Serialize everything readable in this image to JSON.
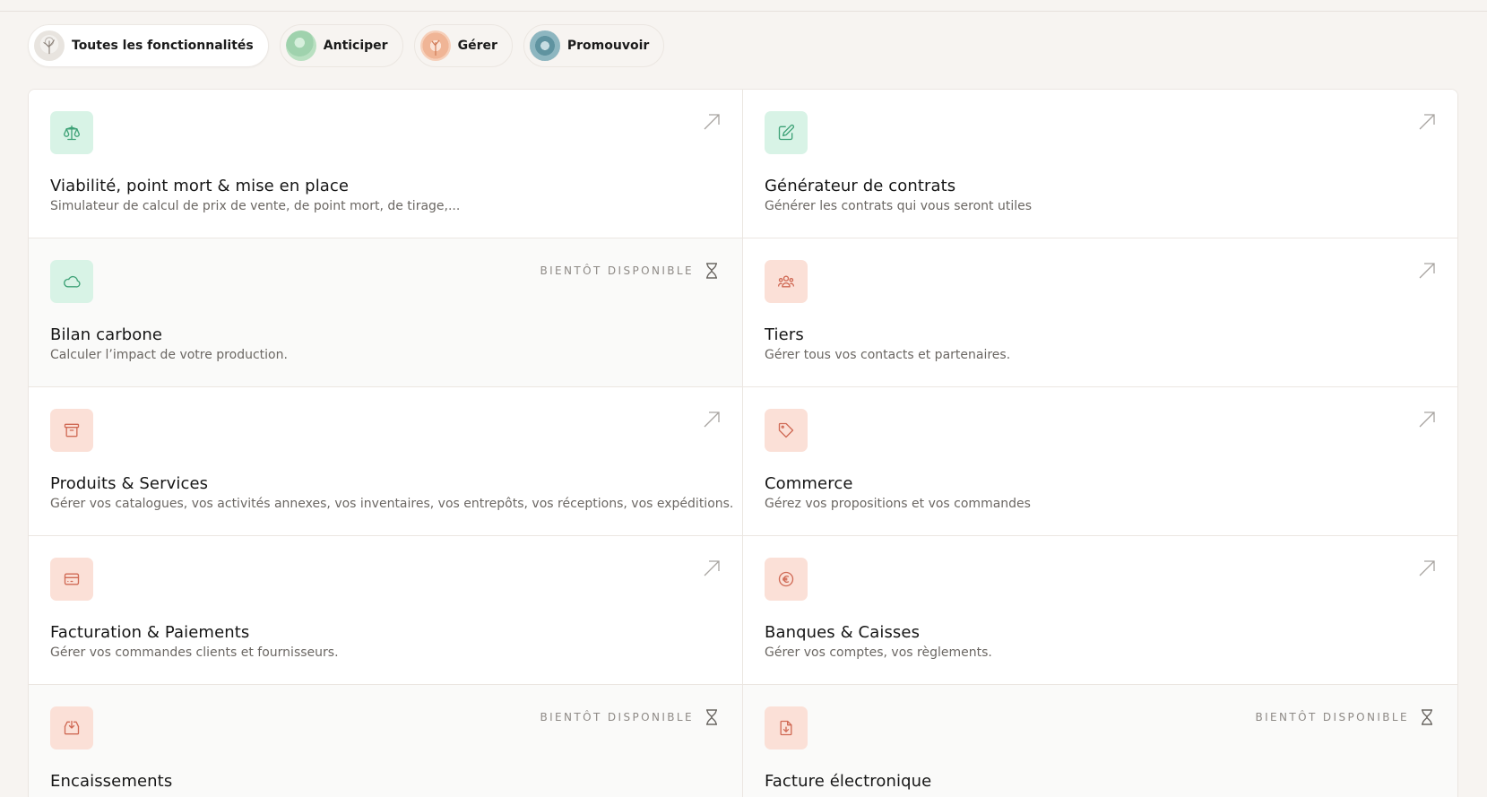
{
  "filters": [
    {
      "label": "Toutes les fonctionnalités",
      "active": true,
      "icon": "tree-thumbnail"
    },
    {
      "label": "Anticiper",
      "active": false,
      "icon": "green-leaf-thumbnail"
    },
    {
      "label": "Gérer",
      "active": false,
      "icon": "orange-tree-thumbnail"
    },
    {
      "label": "Promouvoir",
      "active": false,
      "icon": "blue-coral-thumbnail"
    }
  ],
  "soon_label": "BIENTÔT DISPONIBLE",
  "cards": [
    {
      "title": "Viabilité, point mort & mise en place",
      "desc": "Simulateur de calcul de prix de vente, de point mort, de tirage,...",
      "icon": "scale-icon",
      "color": "#d8f3e6",
      "available": true
    },
    {
      "title": "Générateur de contrats",
      "desc": "Générer les contrats qui vous seront utiles",
      "icon": "edit-icon",
      "color": "#d8f3e6",
      "available": true
    },
    {
      "title": "Bilan carbone",
      "desc": "Calculer l’impact de votre production.",
      "icon": "cloud-icon",
      "color": "#d8f3e6",
      "available": false
    },
    {
      "title": "Tiers",
      "desc": "Gérer tous vos contacts et partenaires.",
      "icon": "users-icon",
      "color": "#fbe0d7",
      "available": true
    },
    {
      "title": "Produits & Services",
      "desc": "Gérer vos catalogues, vos activités annexes, vos inventaires, vos entrepôts, vos réceptions, vos expéditions.",
      "icon": "archive-icon",
      "color": "#fbe0d7",
      "available": true
    },
    {
      "title": "Commerce",
      "desc": "Gérez vos propositions et vos commandes",
      "icon": "tag-icon",
      "color": "#fbe0d7",
      "available": true
    },
    {
      "title": "Facturation & Paiements",
      "desc": "Gérer vos commandes clients et fournisseurs.",
      "icon": "card-icon",
      "color": "#fbe0d7",
      "available": true
    },
    {
      "title": "Banques & Caisses",
      "desc": "Gérer vos comptes, vos règlements.",
      "icon": "euro-icon",
      "color": "#fbe0d7",
      "available": true
    },
    {
      "title": "Encaissements",
      "desc": "",
      "icon": "tray-download-icon",
      "color": "#fbe0d7",
      "available": false
    },
    {
      "title": "Facture électronique",
      "desc": "",
      "icon": "file-download-icon",
      "color": "#fbe0d7",
      "available": false
    }
  ]
}
